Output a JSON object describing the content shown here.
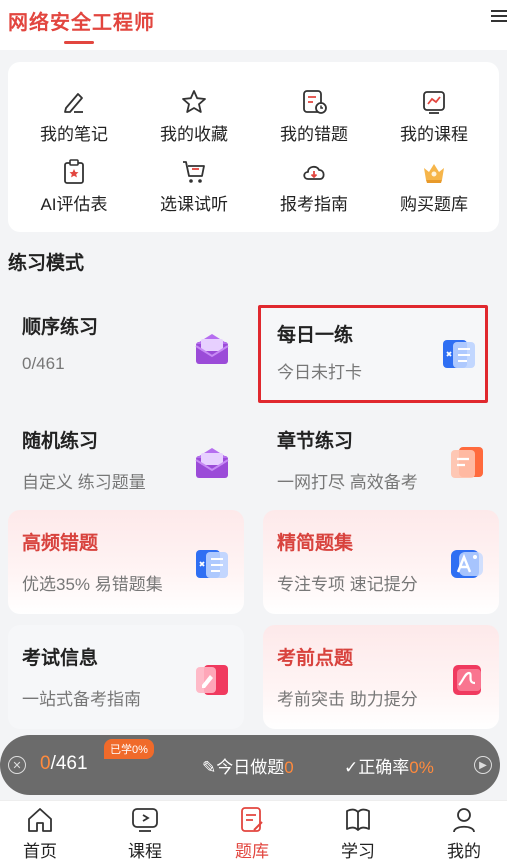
{
  "header": {
    "title": "网络安全工程师"
  },
  "quick": [
    {
      "label": "我的笔记",
      "icon": "note-icon"
    },
    {
      "label": "我的收藏",
      "icon": "star-icon"
    },
    {
      "label": "我的错题",
      "icon": "mistake-icon"
    },
    {
      "label": "我的课程",
      "icon": "course-icon"
    },
    {
      "label": "AI评估表",
      "icon": "ai-eval-icon"
    },
    {
      "label": "选课试听",
      "icon": "cart-icon"
    },
    {
      "label": "报考指南",
      "icon": "cloud-download-icon"
    },
    {
      "label": "购买题库",
      "icon": "crown-icon"
    }
  ],
  "section": {
    "title": "练习模式"
  },
  "cards": [
    {
      "title": "顺序练习",
      "sub": "0/461"
    },
    {
      "title": "每日一练",
      "sub": "今日未打卡"
    },
    {
      "title": "随机练习",
      "sub": "自定义 练习题量"
    },
    {
      "title": "章节练习",
      "sub": "一网打尽 高效备考"
    },
    {
      "title": "高频错题",
      "sub": "优选35% 易错题集"
    },
    {
      "title": "精简题集",
      "sub": "专注专项 速记提分"
    },
    {
      "title": "考试信息",
      "sub": "一站式备考指南"
    },
    {
      "title": "考前点题",
      "sub": "考前突击 助力提分"
    }
  ],
  "progress": {
    "done": "0",
    "total": "/461",
    "badge": "已学0%",
    "today_label": "今日做题",
    "today_value": "0",
    "acc_label": "正确率",
    "acc_value": "0%"
  },
  "tabs": [
    {
      "label": "首页"
    },
    {
      "label": "课程"
    },
    {
      "label": "题库"
    },
    {
      "label": "学习"
    },
    {
      "label": "我的"
    }
  ],
  "colors": {
    "accent": "#e2463f",
    "orange": "#ff8a3d"
  }
}
